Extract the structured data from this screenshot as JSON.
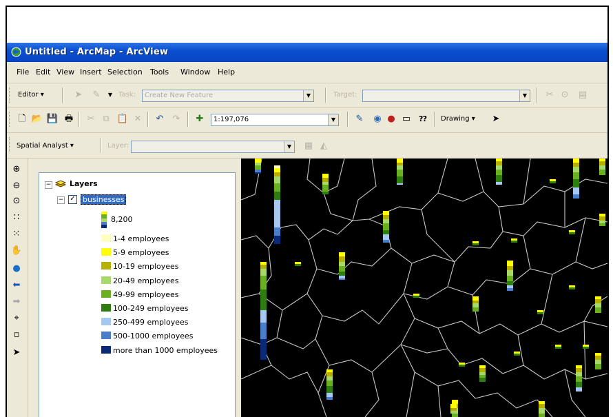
{
  "window": {
    "title": "Untitled - ArcMap - ArcView",
    "menus": [
      "File",
      "Edit",
      "View",
      "Insert",
      "Selection",
      "Tools",
      "Window",
      "Help"
    ]
  },
  "editor_toolbar": {
    "editor_label": "Editor ▾",
    "task_label": "Task:",
    "task_value": "Create New Feature",
    "target_label": "Target:",
    "target_value": ""
  },
  "standard_toolbar": {
    "scale_value": "1:197,076",
    "drawing_label": "Drawing ▾"
  },
  "spatial_toolbar": {
    "spatial_label": "Spatial Analyst ▾",
    "layer_label": "Layer:",
    "layer_value": ""
  },
  "toc": {
    "root_label": "Layers",
    "layer_label": "businesses",
    "chart_size_label": "8,200",
    "legend": [
      {
        "label": "1-4 employees",
        "color": "#ffffc0"
      },
      {
        "label": "5-9 employees",
        "color": "#ffff00"
      },
      {
        "label": "10-19 employees",
        "color": "#b8b000"
      },
      {
        "label": "20-49 employees",
        "color": "#a6d96a"
      },
      {
        "label": "49-99 employees",
        "color": "#6ab020"
      },
      {
        "label": "100-249 employees",
        "color": "#2e7d10"
      },
      {
        "label": "250-499 employees",
        "color": "#a6c8f0"
      },
      {
        "label": "500-1000 employees",
        "color": "#4a7ec8"
      },
      {
        "label": "more than 1000 employees",
        "color": "#0a2a78"
      }
    ]
  },
  "colors": {
    "titlebar": "#0a4fd0",
    "map_background": "#000000",
    "boundaries": "#c8c8c8"
  }
}
